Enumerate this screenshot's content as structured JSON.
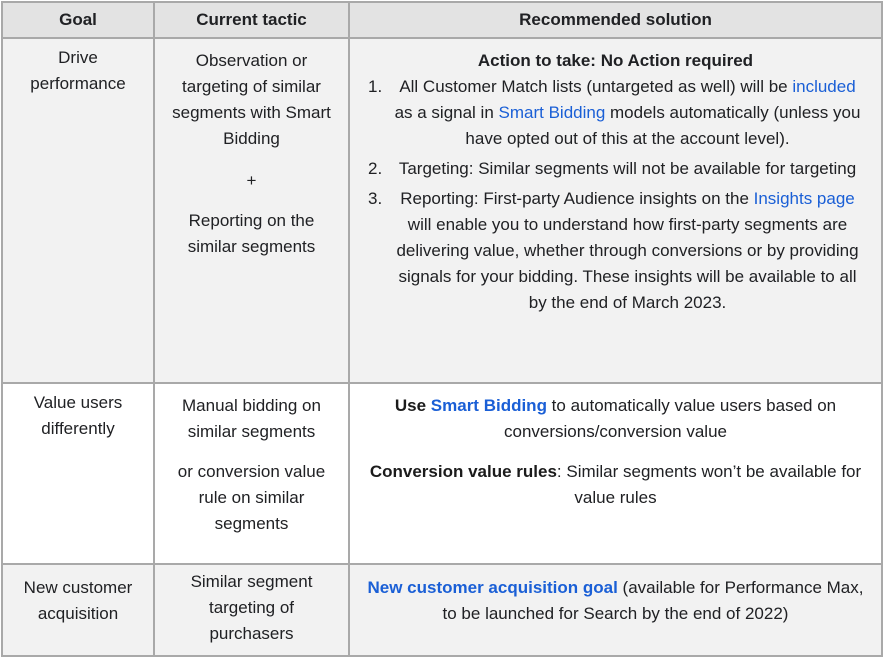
{
  "table": {
    "headers": {
      "goal": "Goal",
      "tactic": "Current tactic",
      "solution": "Recommended solution"
    },
    "rows": [
      {
        "goal": "Drive performance",
        "tactic": {
          "part1": "Observation or targeting of similar segments with Smart Bidding",
          "plus": "+",
          "part2": "Reporting on the similar segments"
        },
        "solution": {
          "action_title": "Action to take: No Action required",
          "steps": [
            {
              "num": "1.",
              "text_a": "All Customer Match lists (untargeted as well) will be ",
              "link_a": "included",
              "text_b": " as a signal in ",
              "link_b": "Smart Bidding",
              "text_c": " models automatically (unless you have opted out of this at the account level)."
            },
            {
              "num": "2.",
              "text": "Targeting: Similar segments will not be available for targeting"
            },
            {
              "num": "3.",
              "text_a": "Reporting: First-party Audience insights on the ",
              "link": "Insights page",
              "text_b": " will enable you to understand how first-party segments are delivering value, whether through conversions or by providing signals for your bidding. These insights will be available to all by the end of March 2023."
            }
          ]
        }
      },
      {
        "goal": "Value users differently",
        "tactic": {
          "part1": "Manual bidding on similar segments",
          "part2": "or conversion value rule on similar segments"
        },
        "solution": {
          "p1_bold": "Use ",
          "p1_link": "Smart Bidding",
          "p1_text": " to automatically value users based on conversions/conversion value",
          "p2_bold": "Conversion value rules",
          "p2_text": ": Similar segments won’t be available for value rules"
        }
      },
      {
        "goal": "New customer acquisition",
        "tactic": {
          "part1": "Similar segment targeting of purchasers"
        },
        "solution": {
          "link": "New customer acquisition goal",
          "text": " (available for Performance Max, to be launched for Search by the end of 2022)"
        }
      }
    ]
  },
  "colors": {
    "header_bg": "#e3e3e3",
    "row_gray_bg": "#f2f2f2",
    "row_white_bg": "#ffffff",
    "border": "#a9a9a9",
    "link": "#1a5fd6",
    "text": "#202124"
  }
}
